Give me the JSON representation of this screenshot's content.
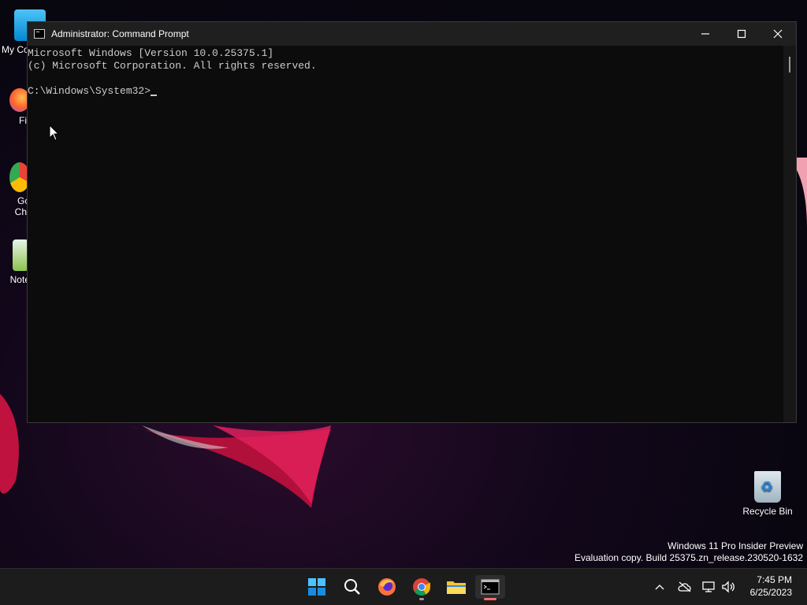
{
  "window": {
    "title": "Administrator: Command Prompt",
    "lines": [
      "Microsoft Windows [Version 10.0.25375.1]",
      "(c) Microsoft Corporation. All rights reserved.",
      "",
      "C:\\Windows\\System32>"
    ]
  },
  "desktop": {
    "icons": [
      {
        "label": "My Co",
        "icon": "computer-icon"
      },
      {
        "label": "Fir",
        "icon": "firefox-icon"
      },
      {
        "label": "Go\nChr",
        "icon": "chrome-icon"
      },
      {
        "label": "Note",
        "icon": "notepad-icon"
      },
      {
        "label": "Recycle Bin",
        "icon": "recycle-bin-icon"
      }
    ]
  },
  "watermark": {
    "line1": "Windows 11 Pro Insider Preview",
    "line2": "Evaluation copy. Build 25375.zn_release.230520-1632"
  },
  "taskbar": {
    "apps": [
      "start-icon",
      "search-icon",
      "firefox-icon",
      "chrome-icon",
      "file-explorer-icon",
      "terminal-icon"
    ],
    "clock": {
      "time": "7:45 PM",
      "date": "6/25/2023"
    }
  },
  "colors": {
    "console_bg": "#0c0c0c",
    "console_text": "#cccccc",
    "accent": "#0078d4"
  }
}
